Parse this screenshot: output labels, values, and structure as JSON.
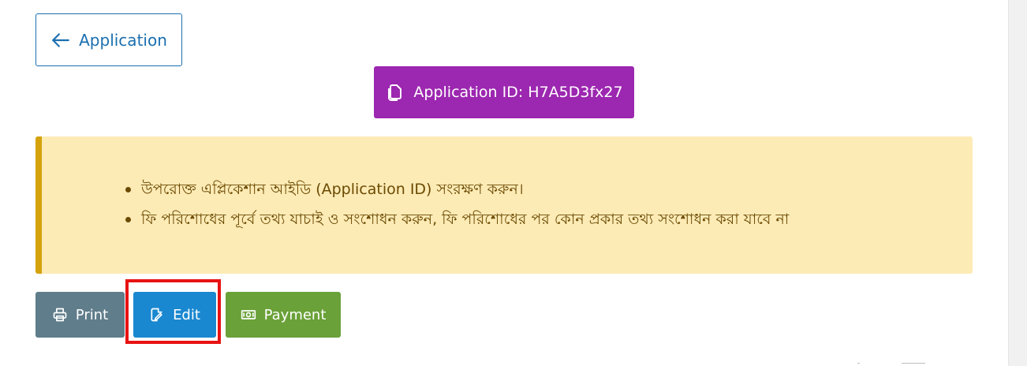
{
  "back_button": {
    "label": "Application",
    "icon": "arrow-left-icon"
  },
  "application_id_button": {
    "label": "Application ID: H7A5D3fx27",
    "icon": "copy-icon",
    "color": "#9c27b0"
  },
  "notice": {
    "background": "#fdebb6",
    "accent": "#d4a20a",
    "items": [
      {
        "text": "উপরোক্ত এপ্লিকেশান আইডি (Application ID) সংরক্ষণ করুন।"
      },
      {
        "text": "ফি পরিশোধের পূর্বে তথ্য যাচাই ও সংশোধন করুন, ফি পরিশোধের পর কোন প্রকার তথ্য সংশোধন করা যাবে না"
      }
    ]
  },
  "actions": {
    "print": {
      "label": "Print",
      "icon": "printer-icon",
      "color": "#607d8b"
    },
    "edit": {
      "label": "Edit",
      "icon": "edit-icon",
      "color": "#1a88d0",
      "highlighted": true,
      "highlight_color": "#e81212"
    },
    "payment": {
      "label": "Payment",
      "icon": "money-icon",
      "color": "#6aa138"
    }
  }
}
